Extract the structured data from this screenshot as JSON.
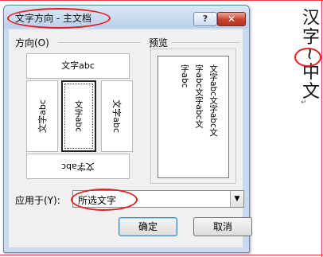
{
  "dialog": {
    "title": "文字方向 - 主文档",
    "help_label": "?",
    "close_label": "✕"
  },
  "direction": {
    "label": "方向(O)",
    "options": [
      {
        "text": "文字abc"
      },
      {
        "text": "文字abc"
      },
      {
        "text": "文字abc"
      },
      {
        "text": "文字abc"
      },
      {
        "text": "文字abc"
      }
    ]
  },
  "preview": {
    "label": "预览",
    "columns": [
      "文字abc文字abc文",
      "字abc文字abc文",
      "字abc"
    ]
  },
  "apply_to": {
    "label": "应用于(Y):",
    "value": "所选文字"
  },
  "buttons": {
    "ok": "确定",
    "cancel": "取消"
  },
  "document": {
    "text": "汉字~中文",
    "mark": "↵"
  }
}
